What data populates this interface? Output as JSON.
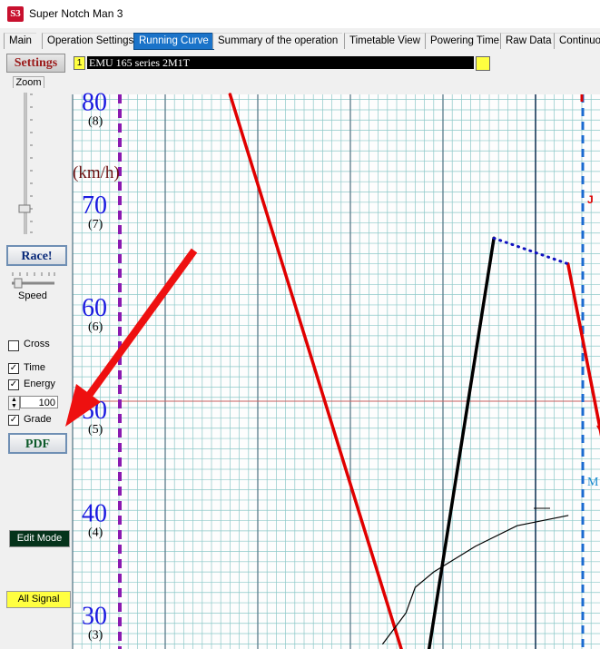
{
  "window": {
    "title": "Super Notch Man 3",
    "icon": "S3"
  },
  "tabs": [
    "Main",
    "Operation Settings",
    "Running Curve",
    "Summary of the operation",
    "Timetable View",
    "Powering Time",
    "Raw Data",
    "Continuou"
  ],
  "active_tab": "Running Curve",
  "toolbar": {
    "settings_label": "Settings",
    "train_number": "1",
    "train_name": "EMU 165 series  2M1T",
    "train_color": "#ffff40"
  },
  "left_panel": {
    "zoom_label": "Zoom",
    "race_label": "Race!",
    "speed_label": "Speed",
    "cross_label": "Cross",
    "cross_checked": false,
    "time_label": "Time",
    "time_checked": true,
    "energy_label": "Energy",
    "energy_checked": true,
    "energy_value": "100",
    "grade_label": "Grade",
    "grade_checked": true,
    "pdf_label": "PDF",
    "edit_mode_label": "Edit Mode",
    "all_signal_label": "All Signal"
  },
  "chart_data": {
    "type": "line",
    "y_unit_label": "(km/h)",
    "y_ticks": [
      {
        "value": 80,
        "label": "80",
        "sublabel": "(8)"
      },
      {
        "value": 70,
        "label": "70",
        "sublabel": "(7)"
      },
      {
        "value": 60,
        "label": "60",
        "sublabel": "(6)"
      },
      {
        "value": 50,
        "label": "50",
        "sublabel": "(5)"
      },
      {
        "value": 40,
        "label": "40",
        "sublabel": "(4)"
      },
      {
        "value": 30,
        "label": "30",
        "sublabel": "(3)"
      }
    ],
    "ylim": [
      26.5,
      80.5
    ],
    "grid": true,
    "series": [
      {
        "color": "#e00000",
        "style": "solid",
        "points": [
          [
            17,
            80.5
          ],
          [
            35.5,
            26.5
          ]
        ]
      },
      {
        "color": "#e00000",
        "style": "solid",
        "points": [
          [
            53.5,
            64
          ],
          [
            57.5,
            45.5
          ]
        ]
      },
      {
        "color": "#000000",
        "style": "solid",
        "points": [
          [
            38.5,
            26.5
          ],
          [
            45.5,
            66.5
          ]
        ]
      },
      {
        "color": "#1010c0",
        "style": "dotted",
        "points": [
          [
            45.5,
            66.5
          ],
          [
            53.5,
            64
          ]
        ]
      },
      {
        "color": "#1010c0",
        "style": "dotted",
        "points": [
          [
            57.5,
            45.5
          ],
          [
            59,
            44.5
          ]
        ]
      },
      {
        "color": "#000000",
        "style": "thin",
        "points": [
          [
            33.5,
            27
          ],
          [
            36,
            30
          ],
          [
            37,
            32.5
          ],
          [
            39,
            34
          ],
          [
            43.5,
            36.5
          ],
          [
            48,
            38.5
          ],
          [
            53.5,
            39.5
          ]
        ]
      }
    ],
    "markers": [
      {
        "shape": "triangle-down",
        "x": 57.5,
        "y": 47.5,
        "color": "#e00000"
      },
      {
        "shape": "hbar",
        "x": 57.5,
        "y": 45.5,
        "color": "#1010c0"
      }
    ],
    "edge_labels": [
      "M",
      "J"
    ]
  }
}
